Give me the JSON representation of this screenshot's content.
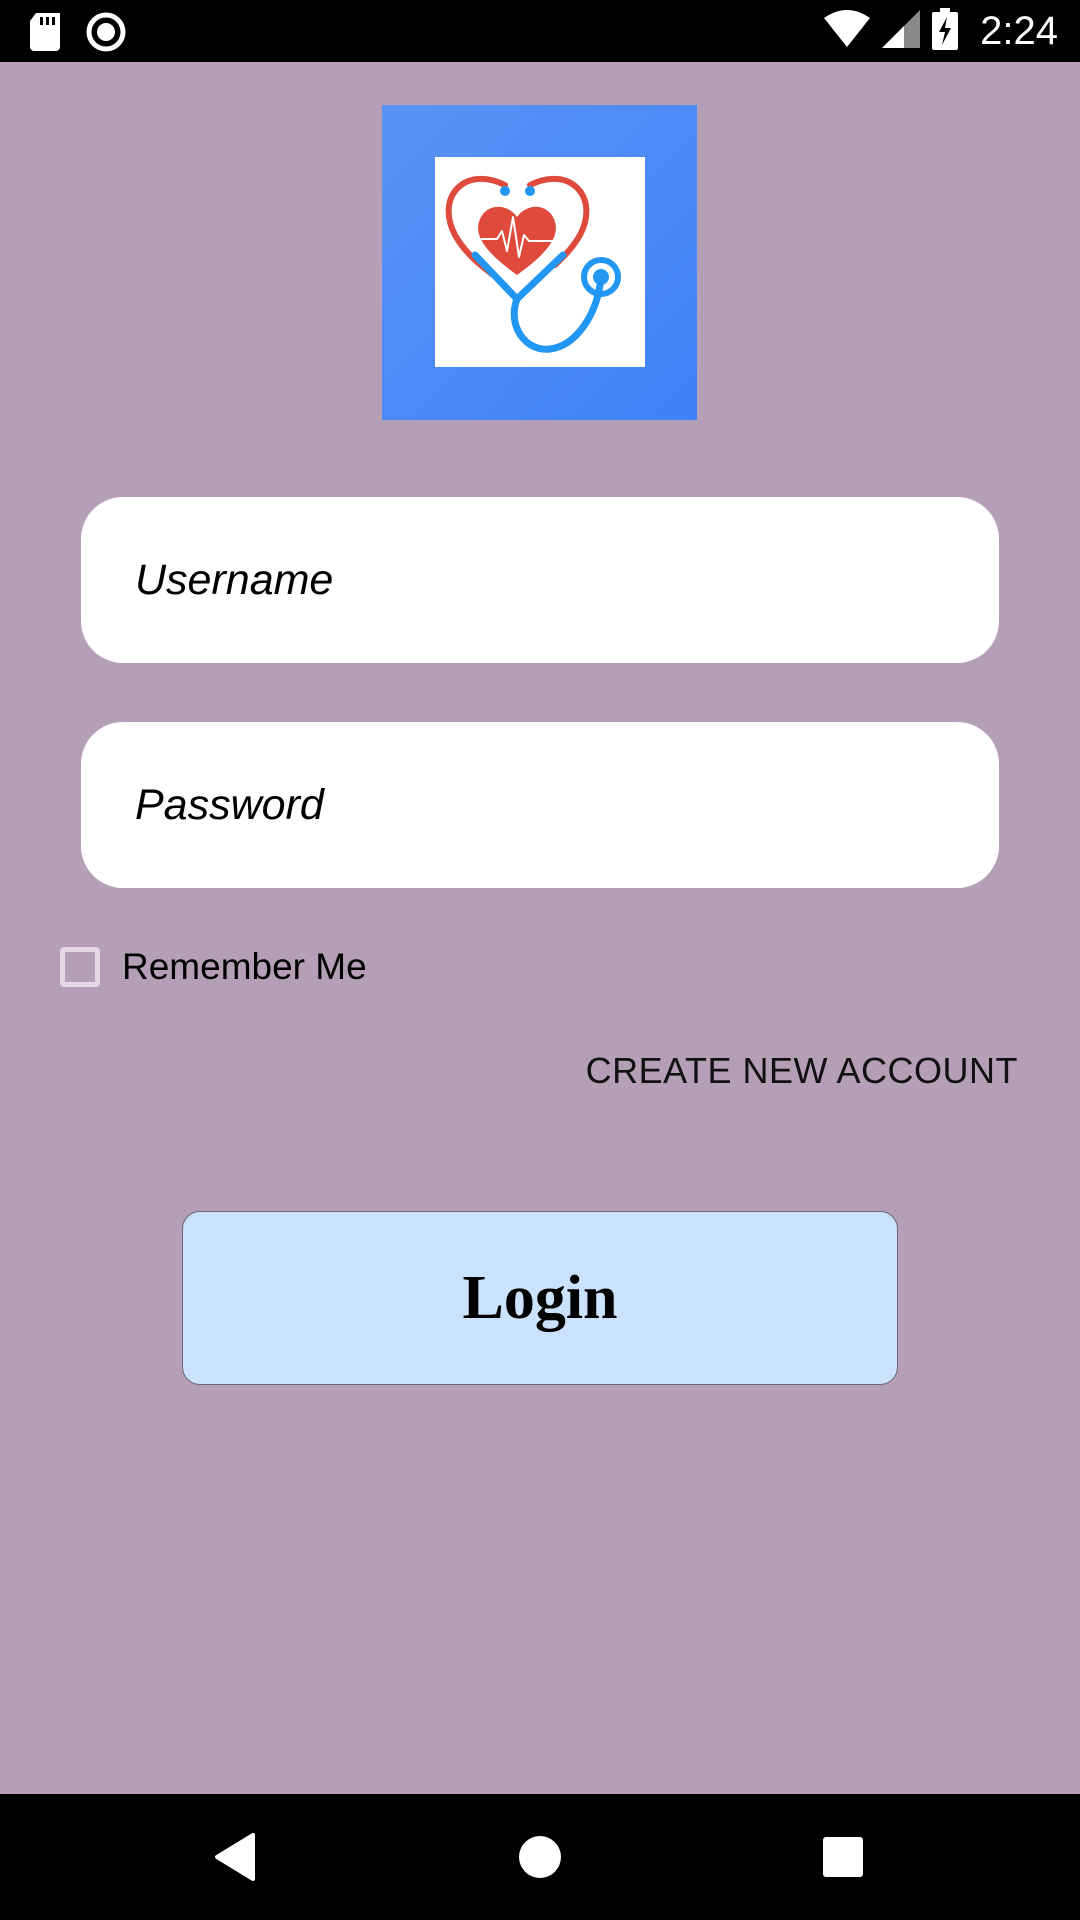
{
  "status_bar": {
    "time": "2:24",
    "icons": [
      "sd-card-icon",
      "record-icon",
      "wifi-icon",
      "signal-icon",
      "battery-charging-icon"
    ]
  },
  "logo": {
    "icon": "heart-stethoscope-icon",
    "colors": {
      "frame": "#4f8df6",
      "heart": "#df4a3d",
      "stethoscope": "#2196f3"
    }
  },
  "form": {
    "username_placeholder": "Username",
    "password_placeholder": "Password",
    "remember_label": "Remember Me",
    "remember_checked": false,
    "create_account_label": "CREATE NEW ACCOUNT",
    "login_label": "Login"
  },
  "nav_bar": {
    "icons": [
      "back-icon",
      "home-icon",
      "recents-icon"
    ]
  },
  "colors": {
    "background": "#b49fb7",
    "login_button": "#cae2fb"
  }
}
